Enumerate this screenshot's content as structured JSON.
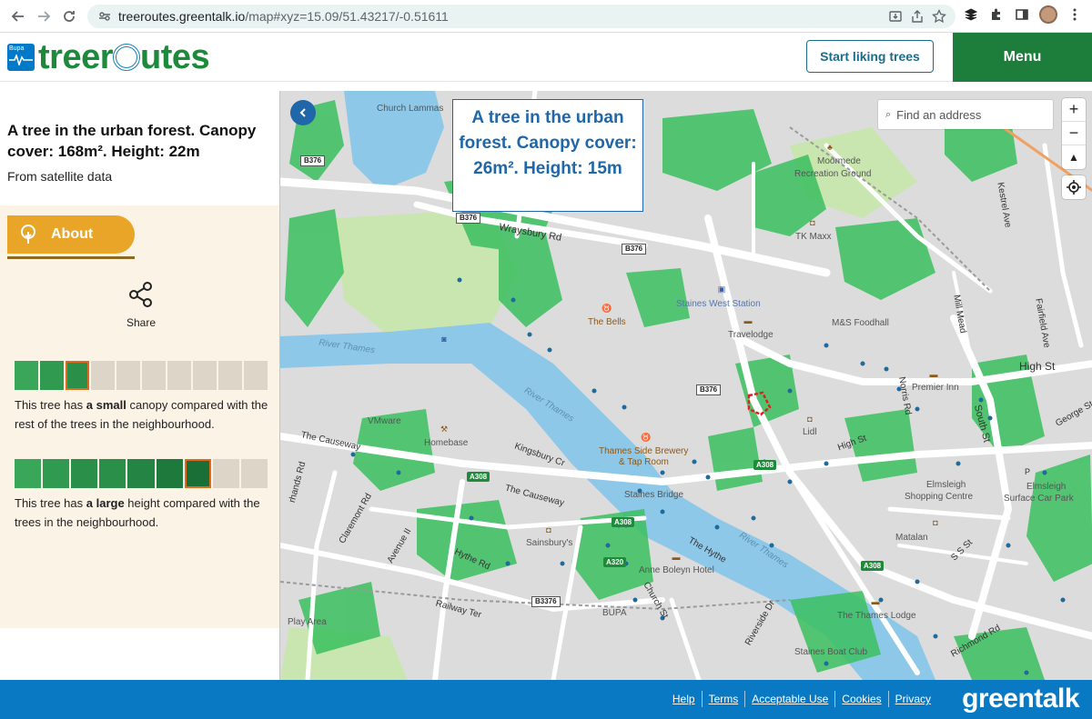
{
  "browser": {
    "url_host": "treeroutes.greentalk.io",
    "url_path": "/map#xyz=15.09/51.43217/-0.51611"
  },
  "header": {
    "bupa_text": "Bupa",
    "brand_pre": "treer",
    "brand_post": "utes",
    "start_label": "Start liking trees",
    "menu_label": "Menu"
  },
  "panel": {
    "title": "A tree in the urban forest. Canopy cover: 168m². Height: 22m",
    "subtitle": "From satellite data",
    "about_label": "About",
    "share_label": "Share",
    "canopy_bar": {
      "filled": 3,
      "total": 10,
      "selected_index": 2
    },
    "canopy_text_pre": "This tree has ",
    "canopy_text_bold": "a small",
    "canopy_text_post": " canopy compared with the rest of the trees in the neighbourhood.",
    "height_bar": {
      "filled": 7,
      "total": 9,
      "selected_index": 6
    },
    "height_text_pre": "This tree has ",
    "height_text_bold": "a large",
    "height_text_post": " height compared with the trees in the neighbourhood."
  },
  "map": {
    "popup_text": "A tree in the urban forest. Canopy cover: 26m². Height: 15m",
    "search_placeholder": "Find an address",
    "zoom_in": "+",
    "zoom_out": "−",
    "labels": {
      "church_lammas": "Church Lammas",
      "moormede": "Moormede",
      "recreation_ground": "Recreation Ground",
      "tk_maxx": "TK Maxx",
      "kestrel_ave": "Kestrel Ave",
      "wraysbury_rd": "Wraysbury Rd",
      "staines_west_station": "Staines West Station",
      "the_bells": "The Bells",
      "travelodge": "Travelodge",
      "ms_foodhall": "M&S Foodhall",
      "mill_mead": "Mill Mead",
      "fairfield_ave": "Fairfield Ave",
      "river_thames_1": "River Thames",
      "river_thames_2": "River Thames",
      "river_thames_3": "River Thames",
      "high_st": "High St",
      "premier_inn": "Premier Inn",
      "norris_rd": "Norris Rd",
      "south_st": "South St",
      "george_st": "George St",
      "vmware": "VMware",
      "homebase": "Homebase",
      "the_causeway_1": "The Causeway",
      "kingsbury_cr": "Kingsbury Cr",
      "thames_side_brewery": "Thames Side Brewery",
      "tap_room": "& Tap Room",
      "lidl": "Lidl",
      "high_st_2": "High St",
      "staines_bridge": "Staines Bridge",
      "the_causeway_2": "The Causeway",
      "elmsleigh": "Elmsleigh",
      "shopping_centre": "Shopping Centre",
      "elmsleigh_2": "Elmsleigh",
      "surface_car_park": "Surface Car Park",
      "claremont_rd": "Claremont Rd",
      "avenue_ii": "Avenue II",
      "sainsburys": "Sainsbury's",
      "hythe_rd": "Hythe Rd",
      "the_hythe": "The Hythe",
      "anne_boleyn": "Anne Boleyn Hotel",
      "matalan": "Matalan",
      "railway_ter": "Railway Ter",
      "church_st": "Church St",
      "play_area": "Play Area",
      "bupa": "BUPA",
      "riverside_dr": "Riverside Dr",
      "the_thames_lodge": "The Thames Lodge",
      "staines_boat_club": "Staines Boat Club",
      "richmond_rd": "Richmond Rd",
      "the_causeway_3": "The Causeway",
      "ss_st": "S S St",
      "rhands_rd": "rhands Rd"
    },
    "shields": {
      "b376_a": "B376",
      "b376_b": "B376",
      "b376_c": "B376",
      "b376_d": "B376",
      "a308_a": "A308",
      "a308_b": "A308",
      "a308_c": "A308",
      "a320": "A320",
      "a308_d": "A308",
      "b3376": "B3376"
    }
  },
  "footer": {
    "links": [
      "Help",
      "Terms",
      "Acceptable Use",
      "Cookies",
      "Privacy"
    ],
    "brand": "greentalk"
  },
  "colors": {
    "brand_green": "#1d8a3b",
    "menu_green": "#1d7d3a",
    "about_orange": "#e8a527",
    "footer_blue": "#0a79c4",
    "river_blue": "#8ec8e8",
    "tree_green": "#3bbf5e",
    "selected_outline": "#e06a1b"
  }
}
